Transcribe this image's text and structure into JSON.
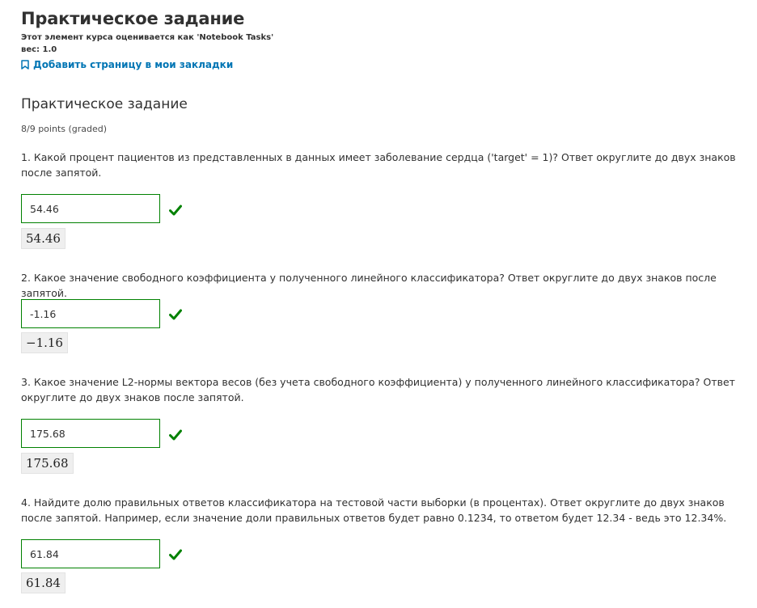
{
  "header": {
    "title": "Практическое задание",
    "graded_as": "Этот элемент курса оценивается как 'Notebook Tasks'",
    "weight": "вес: 1.0",
    "bookmark_label": "Добавить страницу в мои закладки"
  },
  "problem": {
    "title": "Практическое задание",
    "points": "8/9 points (graded)",
    "questions": [
      {
        "text": "1. Какой процент пациентов из представленных в данных имеет заболевание сердца ('target' = 1)? Ответ округлите до двух знаков после запятой.",
        "value": "54.46",
        "preview": "54.46",
        "status": "correct"
      },
      {
        "text": "2. Какое значение свободного коэффициента у полученного линейного классификатора? Ответ округлите до двух знаков после запятой.",
        "value": "-1.16",
        "preview": "−1.16",
        "status": "correct"
      },
      {
        "text": "3. Какое значение L2-нормы вектора весов (без учета свободного коэффициента) у полученного линейного классификатора? Ответ округлите до двух знаков после запятой.",
        "value": "175.68",
        "preview": "175.68",
        "status": "correct"
      },
      {
        "text": "4. Найдите долю правильных ответов классификатора на тестовой части выборки (в процентах). Ответ округлите до двух знаков после запятой. Например, если значение доли правильных ответов будет равно 0.1234, то ответом будет 12.34 - ведь это 12.34%.",
        "value": "61.84",
        "preview": "61.84",
        "status": "correct"
      }
    ]
  },
  "colors": {
    "correct": "#008100",
    "link": "#0075b4"
  }
}
